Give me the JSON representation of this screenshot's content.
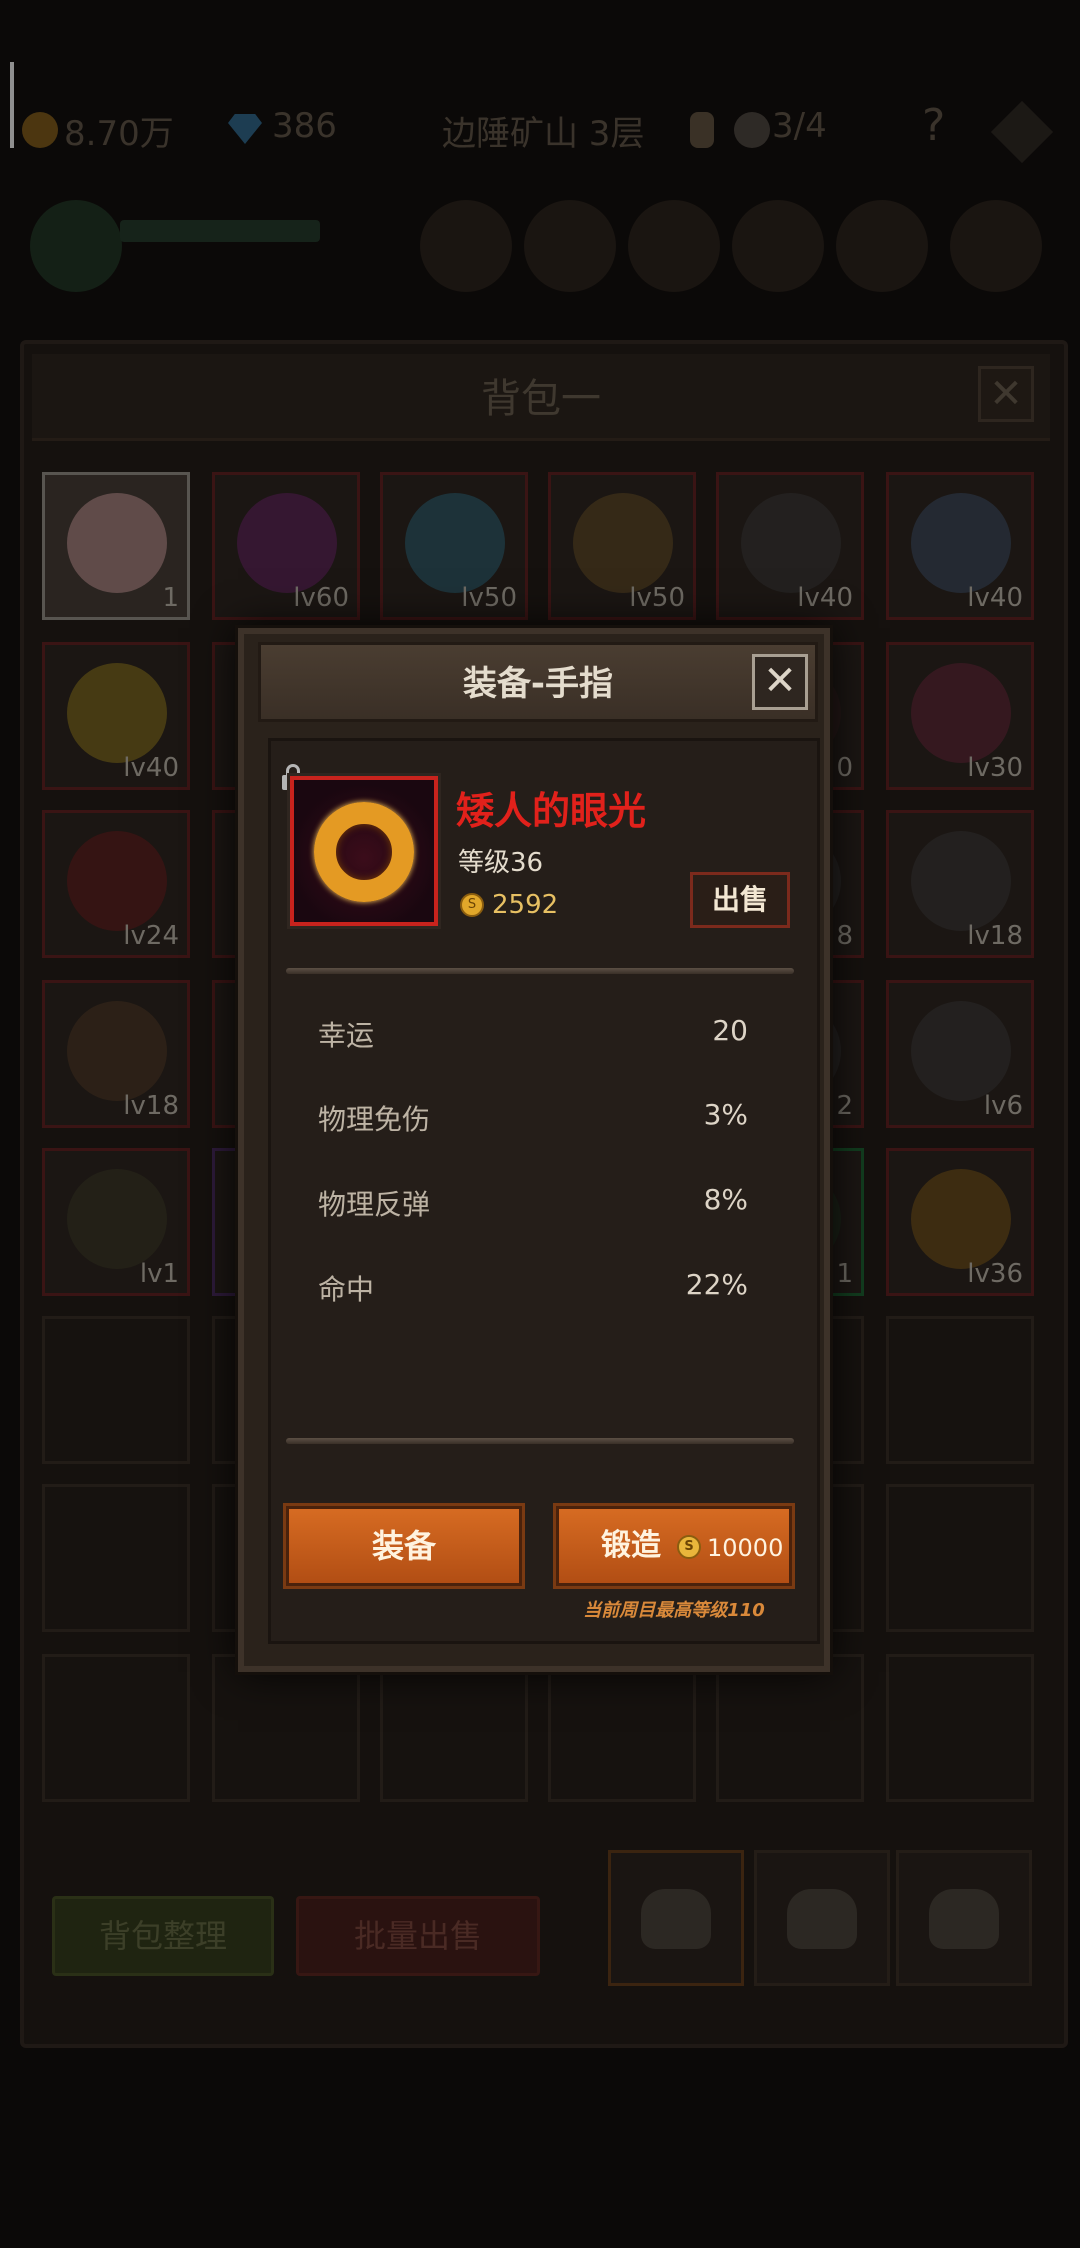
{
  "hud": {
    "gold": "8.70万",
    "gems": "386",
    "location": "边陲矿山 3层",
    "skulls": "3/4",
    "help": "?"
  },
  "bag": {
    "title": "背包一",
    "close": "✕",
    "slots": [
      {
        "label": "1"
      },
      {
        "label": "lv60"
      },
      {
        "label": "lv50"
      },
      {
        "label": "lv50"
      },
      {
        "label": "lv40"
      },
      {
        "label": "lv40"
      },
      {
        "label": "lv40"
      },
      {
        "label": ""
      },
      {
        "label": ""
      },
      {
        "label": ""
      },
      {
        "label": "0"
      },
      {
        "label": "lv30"
      },
      {
        "label": "lv24"
      },
      {
        "label": ""
      },
      {
        "label": ""
      },
      {
        "label": ""
      },
      {
        "label": "8"
      },
      {
        "label": "lv18"
      },
      {
        "label": "lv18"
      },
      {
        "label": ""
      },
      {
        "label": ""
      },
      {
        "label": ""
      },
      {
        "label": "2"
      },
      {
        "label": "lv6"
      },
      {
        "label": "lv1"
      },
      {
        "label": ""
      },
      {
        "label": ""
      },
      {
        "label": ""
      },
      {
        "label": "1"
      },
      {
        "label": "lv36"
      }
    ],
    "sort_label": "背包整理",
    "bulk_sell_label": "批量出售"
  },
  "modal": {
    "title": "装备-手指",
    "close": "✕",
    "item": {
      "name": "矮人的眼光",
      "level": "等级36",
      "price": "2592",
      "coin_symbol": "S",
      "name_color": "#e1211b",
      "icon": "gold-ring-icon"
    },
    "sell_label": "出售",
    "stats": [
      {
        "name": "幸运",
        "value": "20"
      },
      {
        "name": "物理免伤",
        "value": "3%"
      },
      {
        "name": "物理反弹",
        "value": "8%"
      },
      {
        "name": "命中",
        "value": "22%"
      }
    ],
    "equip_label": "装备",
    "forge_label": "锻造",
    "forge_cost": "10000",
    "max_level_note": "当前周目最高等级110"
  }
}
